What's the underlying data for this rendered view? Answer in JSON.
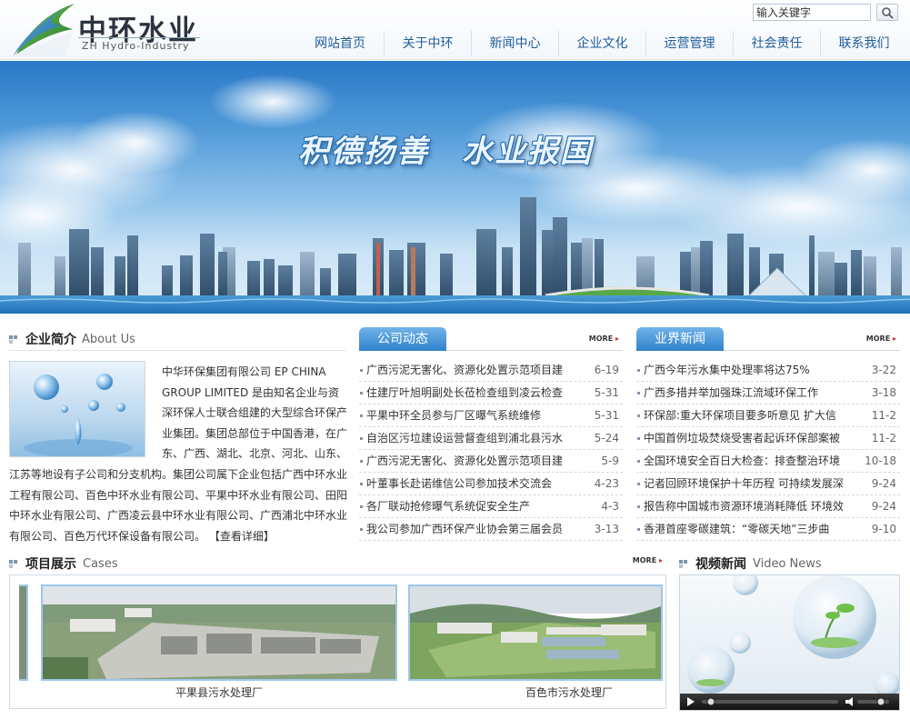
{
  "header": {
    "logo_cn": "中环水业",
    "logo_en": "ZH Hydro-Industry",
    "search_placeholder": "输入关键字",
    "nav": [
      "网站首页",
      "关于中环",
      "新闻中心",
      "企业文化",
      "运营管理",
      "社会责任",
      "联系我们"
    ]
  },
  "banner": {
    "slogan": "积德扬善　水业报国"
  },
  "about": {
    "title_cn": "企业简介",
    "title_en": "About Us",
    "text": "中华环保集团有限公司 EP CHINA GROUP LIMITED 是由知名企业与资深环保人士联合组建的大型综合环保产业集团。集团总部位于中国香港，在广东、广西、湖北、北京、河北、山东、江苏等地设有子公司和分支机构。集团公司属下企业包括广西中环水业工程有限公司、百色中环水业有限公司、平果中环水业有限公司、田阳中环水业有限公司、广西凌云县中环水业有限公司、广西浦北中环水业有限公司、百色万代环保设备有限公司。",
    "more": "【查看详细】"
  },
  "company_news": {
    "tab": "公司动态",
    "more": "MORE",
    "items": [
      {
        "title": "广西污泥无害化、资源化处置示范项目建",
        "date": "6-19"
      },
      {
        "title": "住建厅叶旭明副处长莅检查组到凌云检查",
        "date": "5-31"
      },
      {
        "title": "平果中环全员参与厂区曝气系统维修",
        "date": "5-31"
      },
      {
        "title": "自治区污垃建设运营督查组到浦北县污水",
        "date": "5-24"
      },
      {
        "title": "广西污泥无害化、资源化处置示范项目建",
        "date": "5-9"
      },
      {
        "title": "叶董事长赴诺维信公司参加技术交流会",
        "date": "4-23"
      },
      {
        "title": "各厂联动抢修曝气系统促安全生产",
        "date": "4-3"
      },
      {
        "title": "我公司参加广西环保产业协会第三届会员",
        "date": "3-13"
      }
    ]
  },
  "industry_news": {
    "tab": "业界新闻",
    "more": "MORE",
    "items": [
      {
        "title": "广西今年污水集中处理率将达75%",
        "date": "3-22"
      },
      {
        "title": "广西多措并举加强珠江流域环保工作",
        "date": "3-18"
      },
      {
        "title": "环保部:重大环保项目要多听意见 扩大信",
        "date": "11-2"
      },
      {
        "title": "中国首例垃圾焚烧受害者起诉环保部案被",
        "date": "11-2"
      },
      {
        "title": "全国环境安全百日大检查：排查整治环境",
        "date": "10-18"
      },
      {
        "title": "记者回顾环境保护十年历程 可持续发展深",
        "date": "9-24"
      },
      {
        "title": "报告称中国城市资源环境消耗降低 环境效",
        "date": "9-24"
      },
      {
        "title": "香港首座零碳建筑：“零碳天地”三步曲",
        "date": "9-10"
      }
    ]
  },
  "cases": {
    "title_cn": "项目展示",
    "title_en": "Cases",
    "more": "MORE",
    "items": [
      {
        "caption": "平果县污水处理厂"
      },
      {
        "caption": "百色市污水处理厂"
      }
    ]
  },
  "video": {
    "title_cn": "视频新闻",
    "title_en": "Video News"
  }
}
